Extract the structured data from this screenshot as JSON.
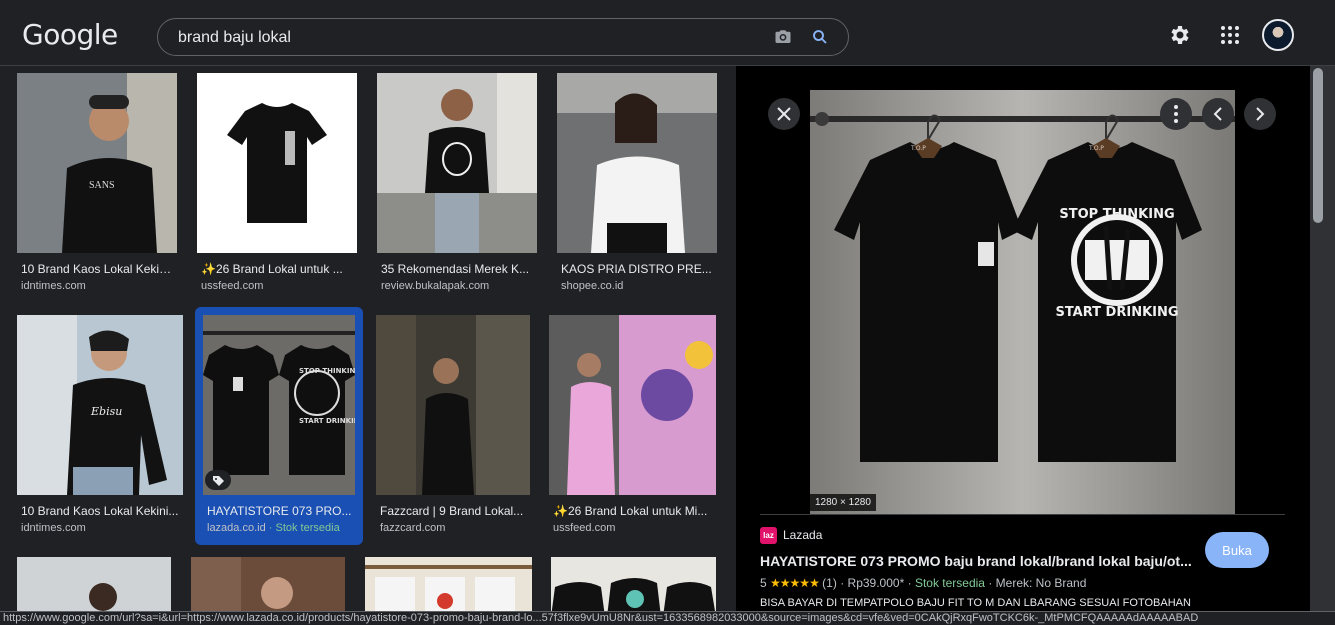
{
  "header": {
    "logo": "Google",
    "search_query": "brand baju lokal"
  },
  "results": [
    {
      "title": "10 Brand Kaos Lokal Kekini...",
      "source": "idntimes.com"
    },
    {
      "title": "✨26 Brand Lokal untuk ...",
      "source": "ussfeed.com"
    },
    {
      "title": "35 Rekomendasi Merek K...",
      "source": "review.bukalapak.com"
    },
    {
      "title": "KAOS PRIA DISTRO PRE...",
      "source": "shopee.co.id"
    },
    {
      "title": "10 Brand Kaos Lokal Kekini...",
      "source": "idntimes.com"
    },
    {
      "title": "HAYATISTORE 073 PRO...",
      "source": "lazada.co.id",
      "extra": " · Stok tersedia"
    },
    {
      "title": "Fazzcard | 9 Brand Lokal...",
      "source": "fazzcard.com"
    },
    {
      "title": "✨26 Brand Lokal untuk Mi...",
      "source": "ussfeed.com"
    }
  ],
  "panel": {
    "dimensions": "1280 × 1280",
    "site": "Lazada",
    "site_icon": "laz",
    "title": "HAYATISTORE 073 PROMO baju brand lokal/brand lokal baju/ot...",
    "open_label": "Buka",
    "rating_value": "5",
    "stars": "★★★★★",
    "rating_count": "(1)",
    "price": "Rp39.000*",
    "stock": "Stok tersedia",
    "brand": "Merek: No Brand",
    "description": "BISA BAYAR DI TEMPATPOLO BAJU FIT TO M DAN LBARANG SESUAI FOTOBAHAN",
    "shirt_label": "T.O.P",
    "print_top": "STOP THINKING",
    "print_bottom": "START DRINKING"
  },
  "status_url": "https://www.google.com/url?sa=i&url=https://www.lazada.co.id/products/hayatistore-073-promo-baju-brand-lo...57f3flxe9vUmU8Nr&ust=1633568982033000&source=images&cd=vfe&ved=0CAkQjRxqFwoTCKC6k-_MtPMCFQAAAAAdAAAAABAD",
  "colors": {
    "accent": "#8ab4f8",
    "selected": "#1a4fb4",
    "stars": "#fbbc04",
    "stock": "#81c995"
  }
}
